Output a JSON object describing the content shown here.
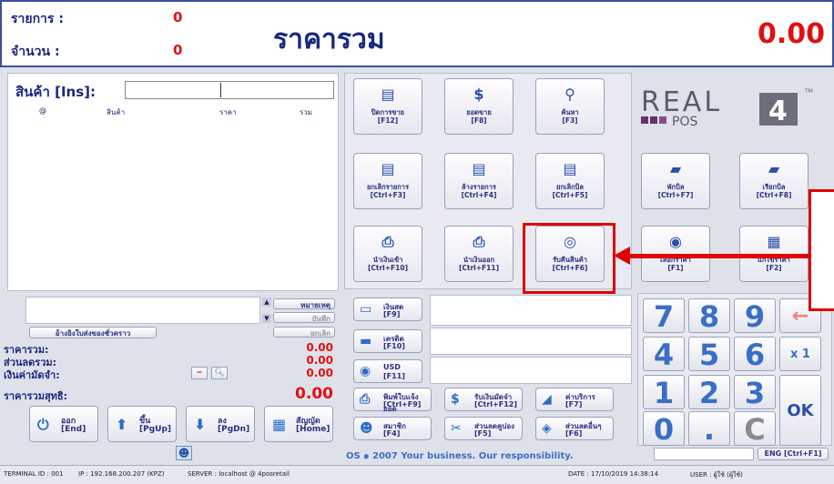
{
  "header": {
    "items_label": "รายการ :",
    "items_value": "0",
    "qty_label": "จำนวน :",
    "qty_value": "0",
    "total_title": "ราคารวม",
    "total_value": "0.00"
  },
  "product": {
    "label": "สินค้า [Ins]:",
    "columns": [
      "@",
      "สินค้า",
      "ราคา",
      "รวม"
    ]
  },
  "function_keys": [
    {
      "name": "close-shift-button",
      "icon": "document-icon",
      "line1": "ปิดการขาย",
      "line2": "[F12]"
    },
    {
      "name": "sales-total-button",
      "icon": "dollar-icon",
      "line1": "ยอดขาย",
      "line2": "[F8]"
    },
    {
      "name": "search-button",
      "icon": "search-icon",
      "line1": "ค้นหา",
      "line2": "[F3]"
    },
    {
      "name": "cancel-item-button",
      "icon": "document-icon",
      "line1": "ยกเลิกรายการ",
      "line2": "[Ctrl+F3]"
    },
    {
      "name": "clear-items-button",
      "icon": "document-icon",
      "line1": "ล้างรายการ",
      "line2": "[Ctrl+F4]"
    },
    {
      "name": "cancel-bill-button",
      "icon": "document-icon",
      "line1": "ยกเลิกบิล",
      "line2": "[Ctrl+F5]"
    },
    {
      "name": "hold-bill-button",
      "icon": "folder-icon",
      "line1": "พักบิล",
      "line2": "[Ctrl+F7]"
    },
    {
      "name": "recall-bill-button",
      "icon": "folder-icon",
      "line1": "เรียกบิล",
      "line2": "[Ctrl+F8]"
    },
    {
      "name": "cash-in-button",
      "icon": "printer-icon",
      "line1": "นำเงินเข้า",
      "line2": "[Ctrl+F10]"
    },
    {
      "name": "cash-out-button",
      "icon": "printer-icon",
      "line1": "นำเงินออก",
      "line2": "[Ctrl+F11]"
    },
    {
      "name": "return-goods-button",
      "icon": "disc-icon",
      "line1": "รับคืนสินค้า",
      "line2": "[Ctrl+F6]"
    },
    {
      "name": "select-price-button",
      "icon": "coin-icon",
      "line1": "เลือกราคา",
      "line2": "[F1]"
    },
    {
      "name": "edit-price-button",
      "icon": "calculator-icon",
      "line1": "แก้ไขราคา",
      "line2": "[F2]"
    }
  ],
  "logo": {
    "text_real": "REAL",
    "text_pos": "POS",
    "text_num": "4",
    "tm": "TM"
  },
  "notes": {
    "note_label": "หมายเหตุ",
    "save_label": "บันทึก",
    "cancel_label": "ยกเลิก",
    "ref_label": "อ้างอิงใบส่งของชั่วคราว"
  },
  "summary": {
    "total_label": "ราคารวม:",
    "total_value": "0.00",
    "discount_label": "ส่วนลดรวม:",
    "discount_value": "0.00",
    "deposit_label": "เงินค่ามัดจำ:",
    "deposit_value": "0.00",
    "net_label": "ราคารวมสุทธิ:",
    "net_value": "0.00"
  },
  "nav_buttons": [
    {
      "name": "exit-button",
      "icon": "power-icon",
      "line1": "ออก",
      "line2": "[End]"
    },
    {
      "name": "page-up-button",
      "icon": "arrow-up-icon",
      "line1": "ขึ้น",
      "line2": "[PgUp]"
    },
    {
      "name": "page-down-button",
      "icon": "arrow-down-icon",
      "line1": "ลง",
      "line2": "[PgDn]"
    },
    {
      "name": "contract-button",
      "icon": "grid-icon",
      "line1": "สัญญัด",
      "line2": "[Home]"
    }
  ],
  "payments": [
    {
      "name": "cash-button",
      "icon": "cash-icon",
      "line1": "เงินสด",
      "line2": "[F9]"
    },
    {
      "name": "credit-button",
      "icon": "card-icon",
      "line1": "เครดิต",
      "line2": "[F10]"
    },
    {
      "name": "usd-button",
      "icon": "coin-icon",
      "line1": "USD",
      "line2": "[F11]"
    }
  ],
  "bottom_actions": [
    {
      "name": "print-invoice-button",
      "icon": "printer-icon",
      "line1": "พิมพ์ใบแจ้งยอด",
      "line2": "[Ctrl+F9]"
    },
    {
      "name": "receive-deposit-button",
      "icon": "dollar-icon",
      "line1": "รับเงินมัดจำ",
      "line2": "[Ctrl+F12]"
    },
    {
      "name": "service-fee-button",
      "icon": "car-icon",
      "line1": "ค่าบริการ",
      "line2": "[F7]"
    },
    {
      "name": "member-button",
      "icon": "person-icon",
      "line1": "สมาชิก",
      "line2": "[F4]"
    },
    {
      "name": "coupon-button",
      "icon": "ticket-icon",
      "line1": "ส่วนลดคูปอง",
      "line2": "[F5]"
    },
    {
      "name": "other-discount-button",
      "icon": "tag-icon",
      "line1": "ส่วนลดอื่นๆ",
      "line2": "[F6]"
    }
  ],
  "numpad": {
    "keys": [
      "7",
      "8",
      "9",
      "4",
      "5",
      "6",
      "1",
      "2",
      "3",
      "0",
      ".",
      "C"
    ],
    "backspace": "←",
    "multiply": "x 1",
    "ok": "OK"
  },
  "marquee": "OS ๑ 2007 Your business. Our responsibility.",
  "lang_button": "ENG [Ctrl+F1]",
  "status": {
    "terminal": "TERMINAL ID : 001",
    "ip": "IP : 192.168.200.207 (KPZ)",
    "server": "SERVER : localhost @ 4posretail",
    "date": "DATE : 17/10/2019 14:38:14",
    "user": "USER : ผู้ใช้ (ผู้ใช้)"
  }
}
